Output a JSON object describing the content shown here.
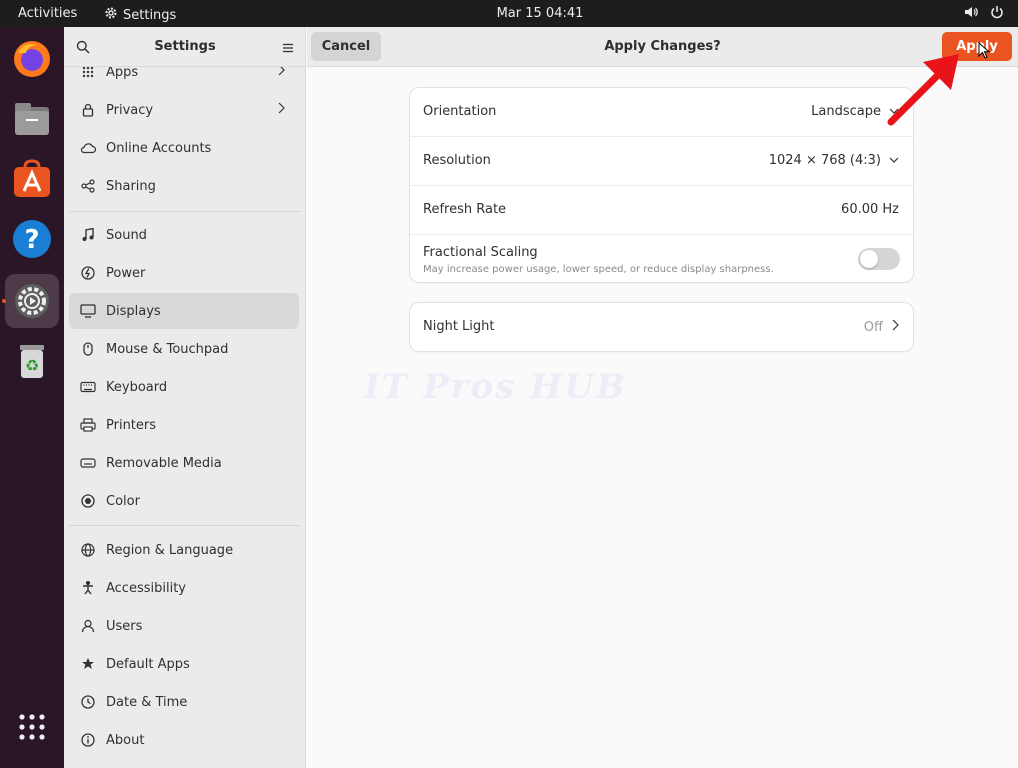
{
  "topbar": {
    "activities": "Activities",
    "app_name": "Settings",
    "clock": "Mar 15  04:41",
    "icons": [
      "volume-icon",
      "power-icon"
    ]
  },
  "dock": {
    "items": [
      "firefox-icon",
      "files-icon",
      "app-center-icon",
      "help-icon",
      "settings-icon",
      "trash-icon"
    ],
    "show_apps": "show-apps-grid-icon"
  },
  "sidebar": {
    "title": "Settings",
    "items": [
      {
        "label": "Apps",
        "icon": "apps-grid-icon"
      },
      {
        "label": "Privacy",
        "icon": "lock-icon"
      },
      {
        "label": "Online Accounts",
        "icon": "cloud-icon"
      },
      {
        "label": "Sharing",
        "icon": "share-icon"
      },
      {
        "label": "Sound",
        "icon": "music-note-icon"
      },
      {
        "label": "Power",
        "icon": "power-icon"
      },
      {
        "label": "Displays",
        "icon": "monitor-icon"
      },
      {
        "label": "Mouse & Touchpad",
        "icon": "mouse-icon"
      },
      {
        "label": "Keyboard",
        "icon": "keyboard-icon"
      },
      {
        "label": "Printers",
        "icon": "printer-icon"
      },
      {
        "label": "Removable Media",
        "icon": "usb-drive-icon"
      },
      {
        "label": "Color",
        "icon": "color-icon"
      },
      {
        "label": "Region & Language",
        "icon": "globe-icon"
      },
      {
        "label": "Accessibility",
        "icon": "accessibility-icon"
      },
      {
        "label": "Users",
        "icon": "user-icon"
      },
      {
        "label": "Default Apps",
        "icon": "star-icon"
      },
      {
        "label": "Date & Time",
        "icon": "clock-icon"
      },
      {
        "label": "About",
        "icon": "info-icon"
      }
    ],
    "selected": "Displays"
  },
  "header": {
    "cancel_label": "Cancel",
    "title": "Apply Changes?",
    "apply_label": "Apply"
  },
  "display_settings": {
    "orientation": {
      "label": "Orientation",
      "value": "Landscape"
    },
    "resolution": {
      "label": "Resolution",
      "value": "1024 × 768 (4:3)"
    },
    "refresh_rate": {
      "label": "Refresh Rate",
      "value": "60.00 Hz"
    },
    "fractional_scaling": {
      "label": "Fractional Scaling",
      "description": "May increase power usage, lower speed, or reduce display sharpness.",
      "enabled": false
    }
  },
  "night_light": {
    "label": "Night Light",
    "value": "Off"
  },
  "watermark": "IT Pros HUB",
  "colors": {
    "accent": "#e95420",
    "arrow": "#e8141a"
  }
}
